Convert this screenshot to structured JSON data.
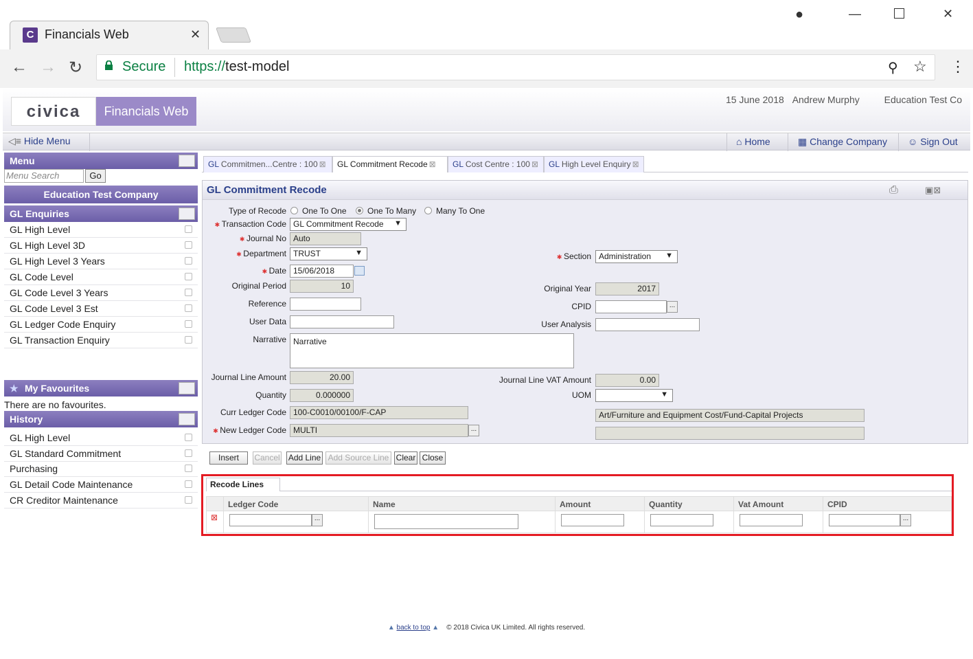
{
  "browser": {
    "tab_title": "Financials Web",
    "tab_favicon": "C",
    "secure_label": "Secure",
    "url_scheme": "https://",
    "url_host": "test-model"
  },
  "header": {
    "logo_text": "civica",
    "app_name": "Financials Web",
    "date": "15 June 2018",
    "user": "Andrew Murphy",
    "company": "Education Test Co"
  },
  "navbar": {
    "hide_menu": "Hide Menu",
    "home": "Home",
    "change_company": "Change Company",
    "sign_out": "Sign Out"
  },
  "sidebar": {
    "menu_title": "Menu",
    "search_placeholder": "Menu Search",
    "go_label": "Go",
    "company": "Education Test Company",
    "enquiries_title": "GL Enquiries",
    "enquiries": [
      "GL High Level",
      "GL High Level 3D",
      "GL High Level 3 Years",
      "GL Code Level",
      "GL Code Level 3 Years",
      "GL Code Level 3 Est",
      "GL Ledger Code Enquiry",
      "GL Transaction Enquiry"
    ],
    "favourites_title": "My Favourites",
    "favourites_empty": "There are no favourites.",
    "history_title": "History",
    "history": [
      "GL High Level",
      "GL Standard Commitment",
      "Purchasing",
      "GL Detail Code Maintenance",
      "CR Creditor Maintenance"
    ]
  },
  "tabs": [
    {
      "prefix": "GL",
      "label": "Commitmen...Centre : 100"
    },
    {
      "prefix": "GL",
      "label": "Commitment Recode"
    },
    {
      "prefix": "GL",
      "label": "Cost Centre : 100"
    },
    {
      "prefix": "GL",
      "label": "High Level Enquiry"
    }
  ],
  "form": {
    "title": "GL Commitment Recode",
    "type_of_recode_label": "Type of Recode",
    "recode_options": [
      "One To One",
      "One To Many",
      "Many To One"
    ],
    "transaction_code_label": "Transaction Code",
    "transaction_code": "GL Commitment Recode",
    "journal_no_label": "Journal No",
    "journal_no": "Auto",
    "department_label": "Department",
    "department": "TRUST",
    "section_label": "Section",
    "section": "Administration",
    "date_label": "Date",
    "date": "15/06/2018",
    "original_period_label": "Original Period",
    "original_period": "10",
    "original_year_label": "Original Year",
    "original_year": "2017",
    "reference_label": "Reference",
    "cpid_label": "CPID",
    "user_data_label": "User Data",
    "user_analysis_label": "User Analysis",
    "narrative_label": "Narrative",
    "narrative": "Narrative",
    "jl_amount_label": "Journal Line Amount",
    "jl_amount": "20.00",
    "jl_vat_label": "Journal Line VAT Amount",
    "jl_vat": "0.00",
    "quantity_label": "Quantity",
    "quantity": "0.000000",
    "uom_label": "UOM",
    "curr_ledger_label": "Curr Ledger Code",
    "curr_ledger": "100-C0010/00100/F-CAP",
    "curr_ledger_desc": "Art/Furniture and Equipment Cost/Fund-Capital Projects",
    "new_ledger_label": "New Ledger Code",
    "new_ledger": "MULTI"
  },
  "buttons": {
    "insert": "Insert",
    "cancel": "Cancel",
    "add_line": "Add Line",
    "add_source_line": "Add Source Line",
    "clear": "Clear",
    "close": "Close"
  },
  "recode_lines": {
    "tab": "Recode Lines",
    "columns": [
      "Ledger Code",
      "Name",
      "Amount",
      "Quantity",
      "Vat Amount",
      "CPID"
    ]
  },
  "footer": {
    "back_to_top": "back to top",
    "copyright": "© 2018 Civica UK Limited. All rights reserved."
  },
  "colors": {
    "accent": "#6b5ea8",
    "link": "#2a3f8a",
    "highlight": "#e41b23"
  }
}
